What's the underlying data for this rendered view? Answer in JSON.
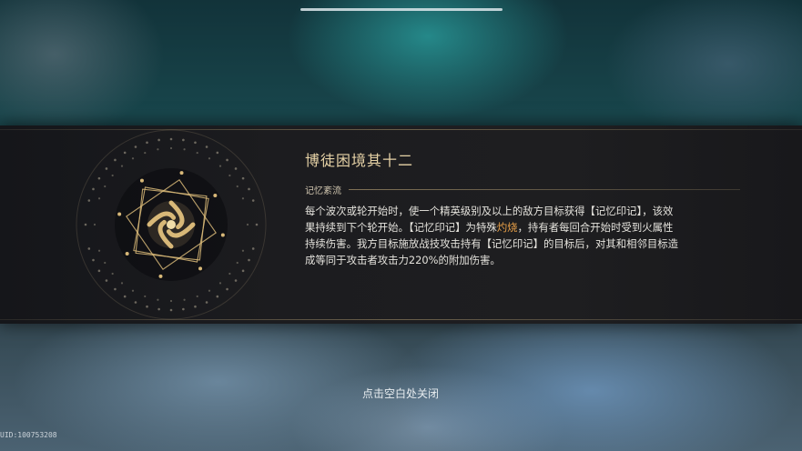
{
  "blessing": {
    "title": "博徒困境其十二",
    "category": "记忆紊流",
    "description_lines": [
      {
        "pre": "每个波次或轮开始时，使一个精英级别及以上的敌方目标获得【记忆印记】，该效",
        "highlight": "",
        "post": ""
      },
      {
        "pre": "果持续到下个轮开始。【记忆印记】为特殊",
        "highlight": "灼烧",
        "post": "，持有者每回合开始时受到火属性"
      },
      {
        "pre": "持续伤害。我方目标施放战技攻击持有【记忆印记】的目标后，对其和相邻目标造",
        "highlight": "",
        "post": ""
      },
      {
        "pre": "成等同于攻击者攻击力220%的附加伤害。",
        "highlight": "",
        "post": ""
      }
    ],
    "emblem_icon": "memory-swirl-icon"
  },
  "close_hint": "点击空白处关闭",
  "uid": "UID:100753208",
  "colors": {
    "title": "#e6d2a6",
    "highlight": "#e8a048",
    "emblem_gold": "#d8b878"
  }
}
